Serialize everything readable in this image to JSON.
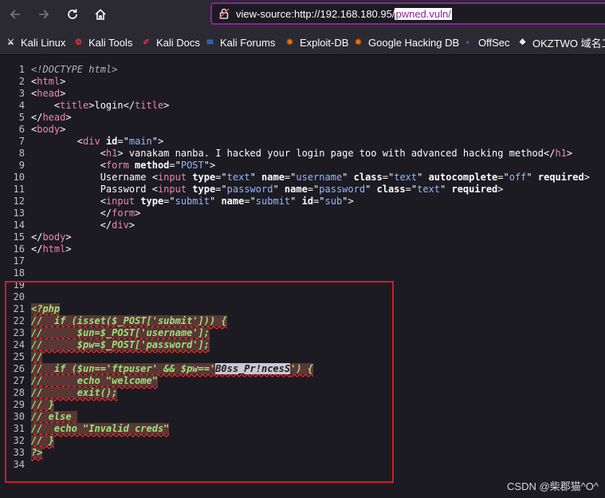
{
  "toolbar": {
    "url_prefix": "view-source:http://192.168.180.95/",
    "url_selected": "pwned.vuln/"
  },
  "bookmarks": [
    {
      "label": "Kali Linux",
      "icon": "kali-dragon-icon",
      "color": "#fbfbfe"
    },
    {
      "label": "Kali Tools",
      "icon": "kali-tools-icon",
      "color": "#e53935"
    },
    {
      "label": "Kali Docs",
      "icon": "kali-docs-icon",
      "color": "#d32f2f"
    },
    {
      "label": "Kali Forums",
      "icon": "kali-forums-icon",
      "color": "#1e88e5"
    },
    {
      "label": "Exploit-DB",
      "icon": "exploit-db-icon",
      "color": "#ef6c00"
    },
    {
      "label": "Google Hacking DB",
      "icon": "ghdb-icon",
      "color": "#ef6c00"
    },
    {
      "label": "OffSec",
      "icon": "offsec-icon",
      "color": "#2979ff"
    },
    {
      "label": "OKZTWO 域名工",
      "icon": "okztwo-icon",
      "color": "#ffffff"
    }
  ],
  "source": {
    "lines": [
      {
        "n": "1",
        "seg": [
          {
            "t": "<!DOCTYPE html>",
            "c": "doctype"
          }
        ]
      },
      {
        "n": "2",
        "seg": [
          {
            "t": "<",
            "c": "txt"
          },
          {
            "t": "html",
            "c": "tag"
          },
          {
            "t": ">",
            "c": "txt"
          }
        ]
      },
      {
        "n": "3",
        "seg": [
          {
            "t": "<",
            "c": "txt"
          },
          {
            "t": "head",
            "c": "tag"
          },
          {
            "t": ">",
            "c": "txt"
          }
        ]
      },
      {
        "n": "4",
        "seg": [
          {
            "t": "    <",
            "c": "txt"
          },
          {
            "t": "title",
            "c": "tag"
          },
          {
            "t": ">login</",
            "c": "txt"
          },
          {
            "t": "title",
            "c": "tag"
          },
          {
            "t": ">",
            "c": "txt"
          }
        ]
      },
      {
        "n": "5",
        "seg": [
          {
            "t": "</",
            "c": "txt"
          },
          {
            "t": "head",
            "c": "tag"
          },
          {
            "t": ">",
            "c": "txt"
          }
        ]
      },
      {
        "n": "6",
        "seg": [
          {
            "t": "<",
            "c": "txt"
          },
          {
            "t": "body",
            "c": "tag"
          },
          {
            "t": ">",
            "c": "txt"
          }
        ]
      },
      {
        "n": "7",
        "seg": [
          {
            "t": "        <",
            "c": "txt"
          },
          {
            "t": "div",
            "c": "tag"
          },
          {
            "t": " id",
            "c": "attr"
          },
          {
            "t": "=\"",
            "c": "txt"
          },
          {
            "t": "main",
            "c": "val"
          },
          {
            "t": "\">",
            "c": "txt"
          }
        ]
      },
      {
        "n": "8",
        "seg": [
          {
            "t": "            <",
            "c": "txt"
          },
          {
            "t": "h1",
            "c": "tag"
          },
          {
            "t": "> vanakam nanba. I hacked your login page too with advanced hacking method</",
            "c": "txt"
          },
          {
            "t": "h1",
            "c": "tag"
          },
          {
            "t": ">",
            "c": "txt"
          }
        ]
      },
      {
        "n": "9",
        "seg": [
          {
            "t": "            <",
            "c": "txt"
          },
          {
            "t": "form",
            "c": "tag"
          },
          {
            "t": " method",
            "c": "attr"
          },
          {
            "t": "=\"",
            "c": "txt"
          },
          {
            "t": "POST",
            "c": "val"
          },
          {
            "t": "\">",
            "c": "txt"
          }
        ]
      },
      {
        "n": "10",
        "seg": [
          {
            "t": "            Username <",
            "c": "txt"
          },
          {
            "t": "input",
            "c": "tag"
          },
          {
            "t": " type",
            "c": "attr"
          },
          {
            "t": "=\"",
            "c": "txt"
          },
          {
            "t": "text",
            "c": "val"
          },
          {
            "t": "\"",
            "c": "txt"
          },
          {
            "t": " name",
            "c": "attr"
          },
          {
            "t": "=\"",
            "c": "txt"
          },
          {
            "t": "username",
            "c": "val"
          },
          {
            "t": "\"",
            "c": "txt"
          },
          {
            "t": " class",
            "c": "attr"
          },
          {
            "t": "=\"",
            "c": "txt"
          },
          {
            "t": "text",
            "c": "val"
          },
          {
            "t": "\"",
            "c": "txt"
          },
          {
            "t": " autocomplete",
            "c": "attr"
          },
          {
            "t": "=\"",
            "c": "txt"
          },
          {
            "t": "off",
            "c": "val"
          },
          {
            "t": "\"",
            "c": "txt"
          },
          {
            "t": " required",
            "c": "attr"
          },
          {
            "t": ">",
            "c": "txt"
          }
        ]
      },
      {
        "n": "11",
        "seg": [
          {
            "t": "            Password <",
            "c": "txt"
          },
          {
            "t": "input",
            "c": "tag"
          },
          {
            "t": " type",
            "c": "attr"
          },
          {
            "t": "=\"",
            "c": "txt"
          },
          {
            "t": "password",
            "c": "val"
          },
          {
            "t": "\"",
            "c": "txt"
          },
          {
            "t": " name",
            "c": "attr"
          },
          {
            "t": "=\"",
            "c": "txt"
          },
          {
            "t": "password",
            "c": "val"
          },
          {
            "t": "\"",
            "c": "txt"
          },
          {
            "t": " class",
            "c": "attr"
          },
          {
            "t": "=\"",
            "c": "txt"
          },
          {
            "t": "text",
            "c": "val"
          },
          {
            "t": "\"",
            "c": "txt"
          },
          {
            "t": " required",
            "c": "attr"
          },
          {
            "t": ">",
            "c": "txt"
          }
        ]
      },
      {
        "n": "12",
        "seg": [
          {
            "t": "            <",
            "c": "txt"
          },
          {
            "t": "input",
            "c": "tag"
          },
          {
            "t": " type",
            "c": "attr"
          },
          {
            "t": "=\"",
            "c": "txt"
          },
          {
            "t": "submit",
            "c": "val"
          },
          {
            "t": "\"",
            "c": "txt"
          },
          {
            "t": " name",
            "c": "attr"
          },
          {
            "t": "=\"",
            "c": "txt"
          },
          {
            "t": "submit",
            "c": "val"
          },
          {
            "t": "\"",
            "c": "txt"
          },
          {
            "t": " id",
            "c": "attr"
          },
          {
            "t": "=\"",
            "c": "txt"
          },
          {
            "t": "sub",
            "c": "val"
          },
          {
            "t": "\">",
            "c": "txt"
          }
        ]
      },
      {
        "n": "13",
        "seg": [
          {
            "t": "            </",
            "c": "txt"
          },
          {
            "t": "form",
            "c": "tag"
          },
          {
            "t": ">",
            "c": "txt"
          }
        ]
      },
      {
        "n": "14",
        "seg": [
          {
            "t": "            </",
            "c": "txt"
          },
          {
            "t": "div",
            "c": "tag"
          },
          {
            "t": ">",
            "c": "txt"
          }
        ]
      },
      {
        "n": "15",
        "seg": [
          {
            "t": "</",
            "c": "txt"
          },
          {
            "t": "body",
            "c": "tag"
          },
          {
            "t": ">",
            "c": "txt"
          }
        ]
      },
      {
        "n": "16",
        "seg": [
          {
            "t": "</",
            "c": "txt"
          },
          {
            "t": "html",
            "c": "tag"
          },
          {
            "t": ">",
            "c": "txt"
          }
        ]
      },
      {
        "n": "17",
        "seg": []
      },
      {
        "n": "18",
        "seg": []
      },
      {
        "n": "19",
        "seg": []
      },
      {
        "n": "20",
        "seg": []
      },
      {
        "n": "21",
        "seg": [
          {
            "t": "<?php",
            "c": "php"
          }
        ]
      },
      {
        "n": "22",
        "seg": [
          {
            "t": "//  if (isset($_POST['submit'])) {",
            "c": "php"
          }
        ]
      },
      {
        "n": "23",
        "seg": [
          {
            "t": "//      $un=$_POST['username'];",
            "c": "php"
          }
        ]
      },
      {
        "n": "24",
        "seg": [
          {
            "t": "//      $pw=$_POST['password'];",
            "c": "php"
          }
        ]
      },
      {
        "n": "25",
        "seg": [
          {
            "t": "//",
            "c": "php"
          }
        ]
      },
      {
        "n": "26",
        "seg": [
          {
            "t": "//  if ($un=='ftpuser' && $pw=='",
            "c": "php"
          },
          {
            "t": "B0ss_Pr!ncesS",
            "c": "php pwd"
          },
          {
            "t": "') {",
            "c": "php"
          }
        ]
      },
      {
        "n": "27",
        "seg": [
          {
            "t": "//      echo \"welcome\"",
            "c": "php"
          }
        ]
      },
      {
        "n": "28",
        "seg": [
          {
            "t": "//      exit();",
            "c": "php"
          }
        ]
      },
      {
        "n": "29",
        "seg": [
          {
            "t": "// }",
            "c": "php"
          }
        ]
      },
      {
        "n": "30",
        "seg": [
          {
            "t": "// else ",
            "c": "php"
          }
        ]
      },
      {
        "n": "31",
        "seg": [
          {
            "t": "//  echo \"Invalid creds\"",
            "c": "php"
          }
        ]
      },
      {
        "n": "32",
        "seg": [
          {
            "t": "// }",
            "c": "php"
          }
        ]
      },
      {
        "n": "33",
        "seg": [
          {
            "t": "?>",
            "c": "php"
          }
        ]
      },
      {
        "n": "34",
        "seg": []
      }
    ]
  },
  "watermark": "CSDN @柴郡猫^O^"
}
